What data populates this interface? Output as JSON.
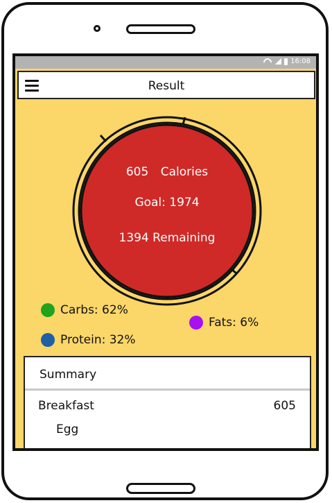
{
  "status_bar": {
    "time": "16:08"
  },
  "app_bar": {
    "title": "Result"
  },
  "gauge": {
    "calories_value": "605",
    "calories_label": "Calories",
    "goal_text": "Goal: 1974",
    "remaining_text": "1394 Remaining",
    "colors": {
      "fill": "#cf2a27",
      "ring": "#fbd669"
    }
  },
  "macros": [
    {
      "label": "Carbs: 62%",
      "color": "#22a31c"
    },
    {
      "label": "Protein: 32%",
      "color": "#1f5fa6"
    },
    {
      "label": "Fats: 6%",
      "color": "#a80ff2"
    }
  ],
  "summary": {
    "title": "Summary",
    "meals": [
      {
        "name": "Breakfast",
        "calories": "605",
        "items": [
          "Egg"
        ]
      }
    ]
  }
}
